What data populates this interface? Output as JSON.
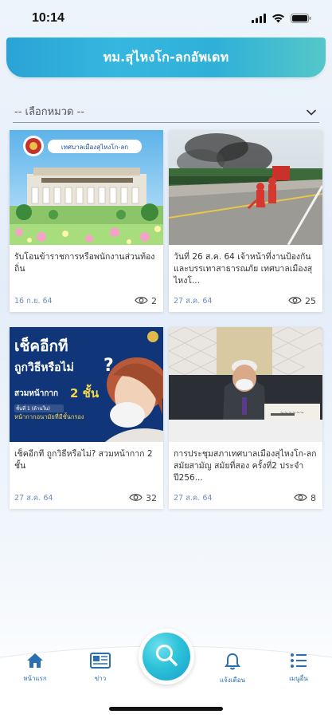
{
  "status_bar": {
    "time": "10:14"
  },
  "header": {
    "title": "ทม.สุไหงโก-ลกอัพเดท"
  },
  "category_select": {
    "placeholder": "-- เลือกหมวด --"
  },
  "cards": [
    {
      "title": "รับโอนข้าราชการหรือพนักงานส่วนท้องถิ่น",
      "date": "16 ก.ย. 64",
      "views": "2",
      "image_caption": "เทศบาลเมืองสุไหงโก-ลก"
    },
    {
      "title": "วันที่ 26 ส.ค. 64 เจ้าหน้าที่งานป้องกันและบรรเทาสาธารณภัย เทศบาลเมืองสุไหงโ...",
      "date": "27 ส.ค. 64",
      "views": "25"
    },
    {
      "title": "เช็คอีกที ถูกวิธีหรือไม่? สวมหน้ากาก 2 ชั้น",
      "date": "27 ส.ค. 64",
      "views": "32",
      "image_lines": [
        "เช็คอีกที",
        "ถูกวิธีหรือไม่",
        "?",
        "สวมหน้ากาก",
        "2 ชั้น",
        "ชั้นที่ 1 (ด้านใน)",
        "หน้ากากอนามัยที่มีชั้นกรอง"
      ]
    },
    {
      "title": "การประชุมสภาเทศบาลเมืองสุไหงโก-ลก สมัยสามัญ สมัยที่สอง ครั้งที่2 ประจำปี256...",
      "date": "27 ส.ค. 64",
      "views": "8"
    }
  ],
  "bottom_nav": {
    "items": [
      {
        "label": "หน้าแรก",
        "icon": "home-icon"
      },
      {
        "label": "ข่าว",
        "icon": "news-icon"
      },
      {
        "label": "แจ้งเตือน",
        "icon": "bell-icon"
      },
      {
        "label": "เมนูอื่น",
        "icon": "menu-list-icon"
      }
    ],
    "center": {
      "icon": "search-icon"
    }
  },
  "colors": {
    "accent": "#2aa3d6",
    "nav_blue": "#2a6fb3",
    "date_blue": "#6b8fb8"
  }
}
